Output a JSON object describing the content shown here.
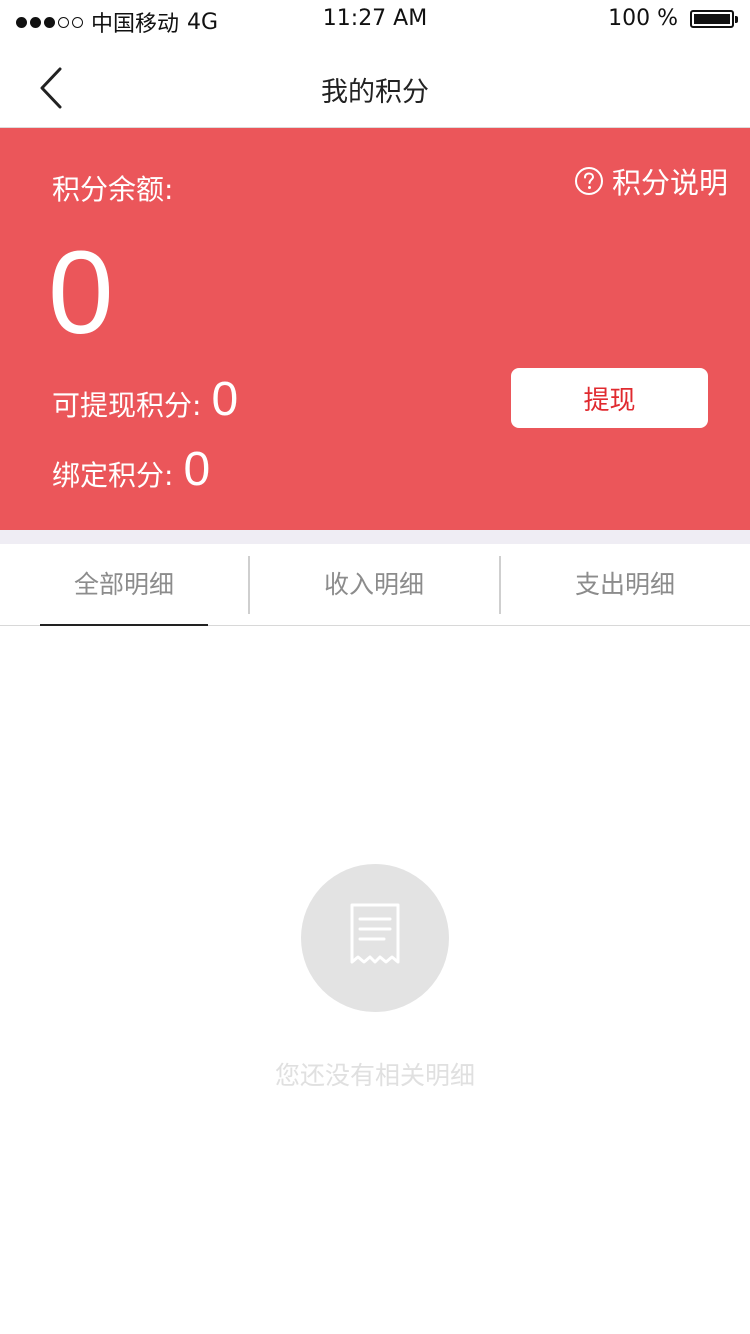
{
  "status_bar": {
    "carrier": "中国移动",
    "network": "4G",
    "time": "11:27 AM",
    "battery_text": "100 %",
    "battery_level_percent": 100,
    "signal_bars_filled": 3,
    "signal_bars_total": 5
  },
  "nav": {
    "title": "我的积分",
    "back_icon": "chevron-left-icon"
  },
  "points": {
    "balance_label": "积分余额:",
    "balance_value": "0",
    "explain_label": "积分说明",
    "explain_icon": "question-circle-icon",
    "withdrawable_label": "可提现积分:",
    "withdrawable_value": "0",
    "bound_label": "绑定积分:",
    "bound_value": "0",
    "withdraw_button": "提现",
    "card_color": "#eb565a",
    "button_text_color": "#e02a2f"
  },
  "tabs": [
    {
      "label": "全部明细",
      "active": true
    },
    {
      "label": "收入明细",
      "active": false
    },
    {
      "label": "支出明细",
      "active": false
    }
  ],
  "empty_state": {
    "icon": "receipt-icon",
    "message": "您还没有相关明细"
  }
}
